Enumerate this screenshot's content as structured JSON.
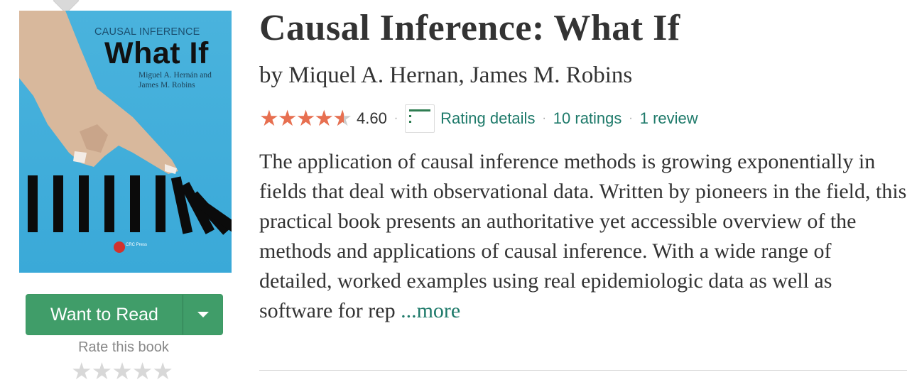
{
  "book": {
    "title": "Causal Inference: What If",
    "by_label": "by",
    "authors": [
      "Miquel A. Hernan",
      "James M. Robins"
    ],
    "author_separator": ", ",
    "average_rating": "4.60",
    "rating_value": 4.6,
    "rating_details_label": "Rating details",
    "ratings_count_label": "10 ratings",
    "reviews_count_label": "1 review",
    "description": "The application of causal inference methods is growing exponentially in fields that deal with observational data. Written by pioneers in the field, this practical book presents an authoritative yet accessible overview of the methods and applications of causal inference. With a wide range of detailed, worked examples using real epidemiologic data as well as software for rep",
    "more_label": "...more"
  },
  "cover": {
    "series": "CAUSAL INFERENCE",
    "title": "What If",
    "authors_line1": "Miguel A. Hernán and",
    "authors_line2": "James M. Robins",
    "publisher": "CRC Press"
  },
  "shelf": {
    "want_to_read_label": "Want to Read",
    "rate_label": "Rate this book",
    "user_rating": 0
  },
  "colors": {
    "star_filled": "#e76f50",
    "star_empty": "#d8d8d8",
    "button_green": "#409d69",
    "link_teal": "#1e7a6a",
    "cover_blue": "#3aa9d8"
  },
  "icons": {
    "rating_details": "bar-chart-icon",
    "dropdown": "caret-down-icon",
    "star": "star-icon"
  }
}
